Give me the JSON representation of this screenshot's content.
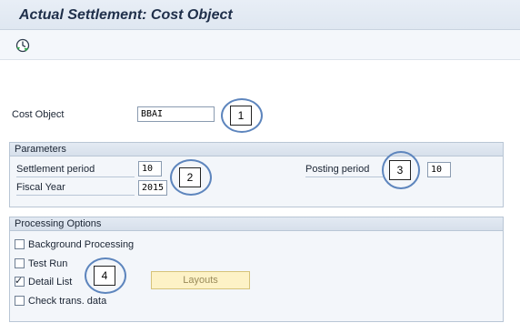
{
  "header": {
    "title": "Actual Settlement: Cost Object"
  },
  "toolbar": {
    "execute_icon": "execute-clock-icon"
  },
  "main": {
    "cost_object": {
      "label": "Cost Object",
      "value": "BBAI"
    },
    "parameters": {
      "title": "Parameters",
      "settlement_period": {
        "label": "Settlement period",
        "value": "10"
      },
      "fiscal_year": {
        "label": "Fiscal Year",
        "value": "2015"
      },
      "posting_period": {
        "label": "Posting period",
        "value": "10"
      }
    },
    "processing_options": {
      "title": "Processing Options",
      "options": [
        {
          "label": "Background Processing",
          "checked": false
        },
        {
          "label": "Test Run",
          "checked": false
        },
        {
          "label": "Detail List",
          "checked": true
        },
        {
          "label": "Check trans. data",
          "checked": false
        }
      ],
      "layouts_button": "Layouts"
    }
  },
  "callouts": [
    "1",
    "2",
    "3",
    "4"
  ],
  "colors": {
    "callout_ring": "#5d85bd",
    "layouts_button_bg": "#fdf2c6",
    "title_text": "#1f2f4a"
  }
}
